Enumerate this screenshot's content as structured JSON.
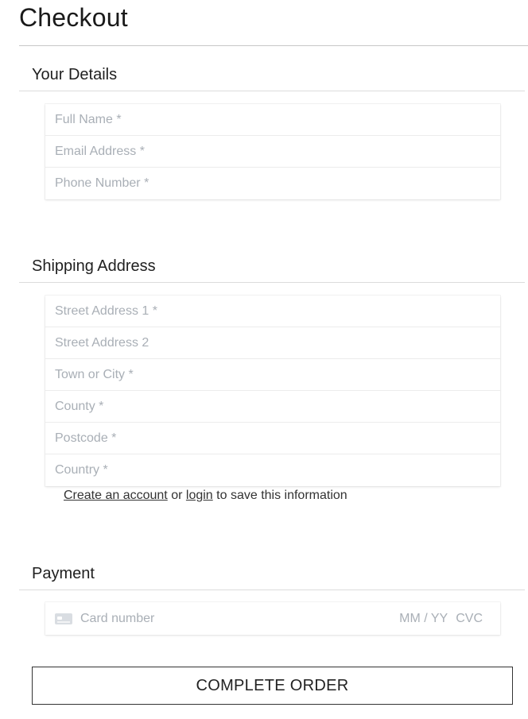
{
  "page": {
    "title": "Checkout"
  },
  "details": {
    "heading": "Your Details",
    "fields": [
      {
        "placeholder": "Full Name *"
      },
      {
        "placeholder": "Email Address *"
      },
      {
        "placeholder": "Phone Number *"
      }
    ]
  },
  "shipping": {
    "heading": "Shipping Address",
    "fields": [
      {
        "placeholder": "Street Address 1 *"
      },
      {
        "placeholder": "Street Address 2"
      },
      {
        "placeholder": "Town or City *"
      },
      {
        "placeholder": "County *"
      },
      {
        "placeholder": "Postcode *"
      },
      {
        "placeholder": "Country *"
      }
    ]
  },
  "account_note": {
    "create_link": "Create an account",
    "or_text": "or",
    "login_link": "login",
    "suffix": "to save this information"
  },
  "payment": {
    "heading": "Payment",
    "card_icon": "credit-card-icon",
    "card_number_placeholder": "Card number",
    "expiry_placeholder": "MM / YY",
    "cvc_placeholder": "CVC"
  },
  "actions": {
    "complete_label": "COMPLETE ORDER"
  }
}
